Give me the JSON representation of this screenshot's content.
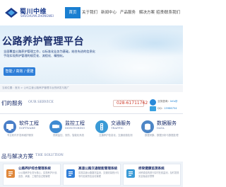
{
  "header": {
    "brand": "蜀川中维",
    "brand_sub": "SHUCHUAN ZHONGWEI",
    "nav": [
      {
        "label": "首页",
        "active": true
      },
      {
        "label": "关于我们",
        "active": false
      },
      {
        "label": "新闻中心",
        "active": false
      },
      {
        "label": "产品服务",
        "active": false
      },
      {
        "label": "解决方案",
        "active": false
      },
      {
        "label": "招贤纳士",
        "active": false
      },
      {
        "label": "联系我们",
        "active": false
      }
    ]
  },
  "banner": {
    "title": "公路养护管理平台",
    "desc": "全面覆盖公路养护管理工作，以标准化业务为基础，结合先进的信息化手段实现养护管理的规范化、流程化、精细化。",
    "button": "智能 / 高效 / 便捷"
  },
  "notice": {
    "text": "当前位置：首页 > 公司主营公路养护管理平台的研发与推广"
  },
  "services_section": {
    "title": "们的服务",
    "sub": "OUR SERVICE",
    "phone": "028-61711762",
    "contact": {
      "qq_label": "业务咨询：",
      "qq_value": "Info@",
      "mail_label": "QQ：",
      "mail_value": "15986754"
    },
    "items": [
      {
        "title": "软件工程",
        "en": "SOFTWARE",
        "desc": "专业软件开发和维护服务",
        "icon": "software-icon",
        "color": "#4a7fc8"
      },
      {
        "title": "监控工程",
        "en": "MONITORING",
        "desc": "视频监控、安防、智能化系统",
        "icon": "monitor-icon",
        "color": "#3f8bd2"
      },
      {
        "title": "交通服务",
        "en": "TRAFFIC",
        "desc": "交通养护信息化、交通设施检测",
        "icon": "traffic-icon",
        "color": "#3a9ad6"
      },
      {
        "title": "数据服务",
        "en": "DATA",
        "desc": "数据采集、数据分析与数据处理",
        "icon": "data-icon",
        "color": "#4d86c6"
      }
    ]
  },
  "solutions_section": {
    "title": "品与解决方案",
    "sub": "THE SOLUTION",
    "items": [
      {
        "title": "公路养护综合管理系统",
        "desc": "以公路养护业务为核心，实现养护计划、巡查、病害、工程的全过程管理",
        "icon": "road-icon",
        "color": "#e0873a"
      },
      {
        "title": "高速公路交通智能管理系统",
        "desc": "实现高速公路路况监测、交通流量统计与事件处置的信息化管理",
        "icon": "highway-icon",
        "color": "#2f7ed8"
      },
      {
        "title": "桥梁健康监测系统",
        "desc": "对桥梁结构进行实时在线监测，及时发现安全隐患并预警",
        "icon": "bridge-icon",
        "color": "#3a9ad6"
      }
    ]
  }
}
